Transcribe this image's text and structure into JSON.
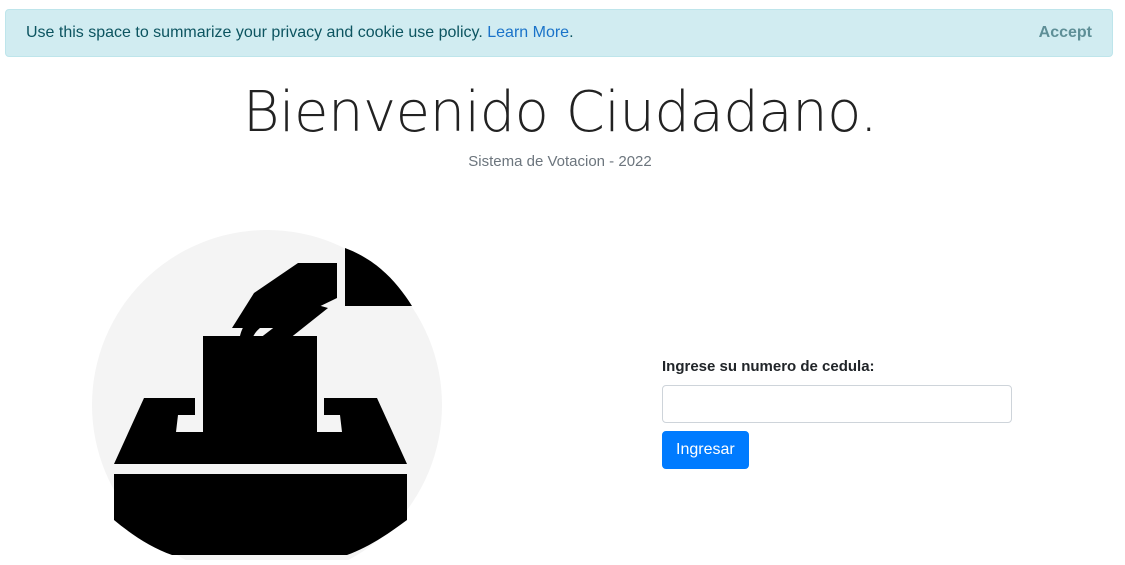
{
  "cookie_banner": {
    "text": "Use this space to summarize your privacy and cookie use policy.",
    "learn_more_label": "Learn More",
    "learn_more_suffix": ".",
    "accept_label": "Accept"
  },
  "hero": {
    "title": "Bienvenido Ciudadano.",
    "subtitle": "Sistema de Votacion - 2022"
  },
  "illustration": {
    "icon": "ballot-box-icon",
    "circle_color": "#f4f4f4",
    "icon_color": "#000000"
  },
  "login_form": {
    "label": "Ingrese su numero de cedula:",
    "input_value": "",
    "input_placeholder": "",
    "submit_label": "Ingresar"
  },
  "colors": {
    "banner_bg": "#d1ecf1",
    "primary": "#007bff"
  }
}
